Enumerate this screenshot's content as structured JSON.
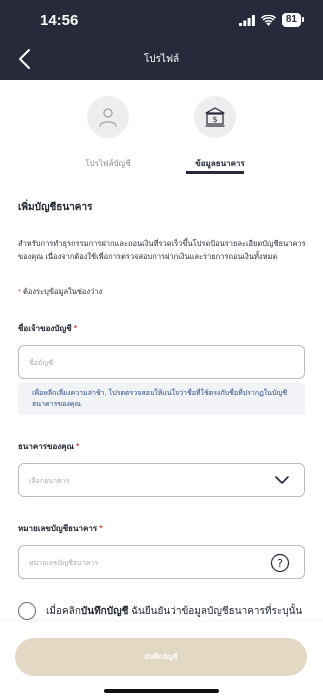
{
  "status_bar": {
    "time": "14:56",
    "battery": "81"
  },
  "header": {
    "title": "โปรไฟล์"
  },
  "tabs": [
    {
      "label": "โปรไฟล์บัญชี",
      "icon": "user-icon",
      "active": false
    },
    {
      "label": "ข้อมูลธนาคาร",
      "icon": "bank-icon",
      "active": true
    }
  ],
  "form": {
    "section_title": "เพิ่มบัญชีธนาคาร",
    "description": "สำหรับการทำธุรกรรมการฝากและถอนเงินที่รวดเร็วขึ้นโปรดป้อนรายละเอียดบัญชีธนาคารของคุณ เนื่องจากต้องใช้เพื่อการตรวจสอบการฝากเงินและรายการถอนเงินทั้งหมด",
    "required_note": "ต้องระบุข้อมูลในช่องว่าง",
    "account_name": {
      "label": "ชื่อเจ้าของบัญชี",
      "placeholder": "ชื่อบัญชี",
      "value": ""
    },
    "account_name_info": "เพื่อหลีกเลี่ยงความล่าช้า, โปรดตรวจสอบให้แน่ใจว่าชื่อที่ใช้ตรงกับชื่อที่ปรากฏในบัญชีธนาคารของคุณ",
    "bank": {
      "label": "ธนาคารของคุณ",
      "placeholder": "เลือกธนาคาร",
      "value": ""
    },
    "account_number": {
      "label": "หมายเลขบัญชีธนาคาร",
      "placeholder": "หมายเลขบัญชีธนาคาร",
      "value": ""
    },
    "consent_prefix": "เมื่อคลิก",
    "consent_bold": "บันทึกบัญชี",
    "consent_rest": " ฉันยืนยันว่าข้อมูลบัญชีธนาคารที่ระบุนั้น",
    "consent_checked": false
  },
  "footer": {
    "submit_label": "บันทึกบัญชี"
  },
  "colors": {
    "header_bg": "#262a3a",
    "submit_bg": "#e3d8c4",
    "required": "#d64545",
    "info_text": "#2c4a86"
  }
}
